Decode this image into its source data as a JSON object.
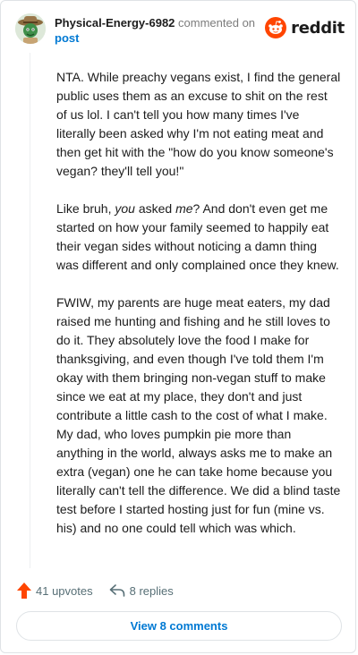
{
  "comment": {
    "author": "Physical-Energy-6982",
    "action_text": "commented on",
    "post_link": "post",
    "brand": "reddit",
    "paragraphs": [
      "NTA. While preachy vegans exist, I find the general public uses them as an excuse to shit on the rest of us lol. I can't tell you how many times I've literally been asked why I'm not eating meat and then get hit with the \"how do you know someone's vegan? they'll tell you!\"",
      "FWIW, my parents are huge meat eaters, my dad raised me hunting and fishing and he still loves to do it. They absolutely love the food I make for thanksgiving, and even though I've told them I'm okay with them bringing non-vegan stuff to make since we eat at my place, they don't and just contribute a little cash to the cost of what I make. My dad, who loves pumpkin pie more than anything in the world, always asks me to make an extra (vegan) one he can take home because you literally can't tell the difference. We did a blind taste test before I started hosting just for fun (mine vs. his) and no one could tell which was which."
    ],
    "p2": {
      "start": "Like bruh, ",
      "em1": "you",
      "mid": " asked ",
      "em2": "me",
      "end": "? And don't even get me started on how your family seemed to happily eat their vegan sides without noticing a damn thing was different and only complained once they knew."
    },
    "upvotes": "41 upvotes",
    "replies": "8 replies",
    "view_comments": "View 8 comments"
  },
  "colors": {
    "accent": "#0079d3",
    "upvote": "#ff4500"
  },
  "icons": [
    "avatar",
    "reddit-snoo-icon",
    "upvote-arrow-icon",
    "reply-icon"
  ]
}
